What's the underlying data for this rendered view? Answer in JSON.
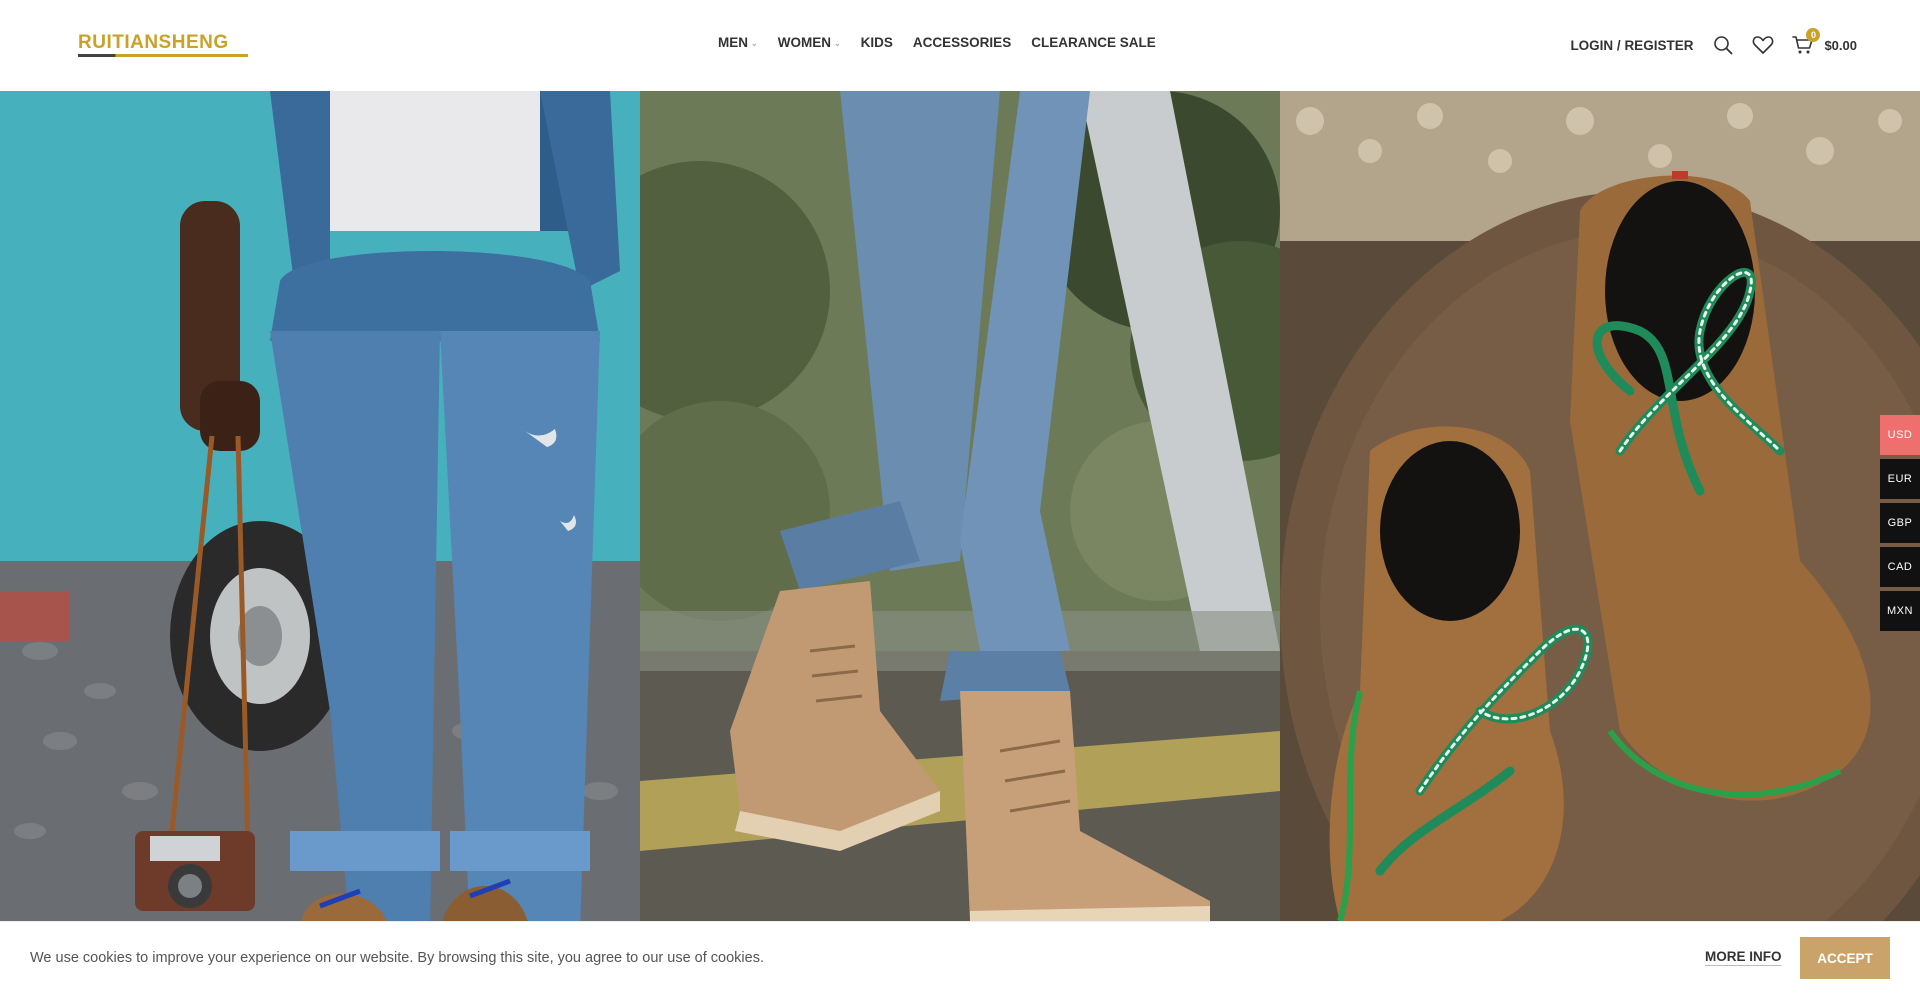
{
  "logo": {
    "text": "RUITIANSHENG"
  },
  "nav": {
    "items": [
      {
        "label": "MEN",
        "has_dropdown": true
      },
      {
        "label": "WOMEN",
        "has_dropdown": true
      },
      {
        "label": "KIDS",
        "has_dropdown": false
      },
      {
        "label": "ACCESSORIES",
        "has_dropdown": false
      },
      {
        "label": "CLEARANCE SALE",
        "has_dropdown": false
      }
    ]
  },
  "header": {
    "login_label": "LOGIN / REGISTER",
    "cart_count": "0",
    "cart_total": "$0.00",
    "icons": [
      "search-icon",
      "heart-icon",
      "cart-icon"
    ]
  },
  "hero": {
    "panels": [
      {
        "scene": "man-in-ripped-jeans-with-camera-by-teal-van"
      },
      {
        "scene": "legs-in-jeans-walking-in-tan-suede-boots"
      },
      {
        "scene": "brown-suede-shoes-with-green-laces-on-tree-stump"
      }
    ]
  },
  "currency": {
    "options": [
      "USD",
      "EUR",
      "GBP",
      "CAD",
      "MXN"
    ],
    "selected": "USD"
  },
  "cookie": {
    "message": "We use cookies to improve your experience on our website. By browsing this site, you agree to our use of cookies.",
    "more_info_label": "MORE INFO",
    "accept_label": "ACCEPT"
  },
  "colors": {
    "accent_gold": "#c9a227",
    "accept_button": "#c9a36a",
    "currency_active": "#ef6f6f",
    "currency_bg": "#111111"
  }
}
